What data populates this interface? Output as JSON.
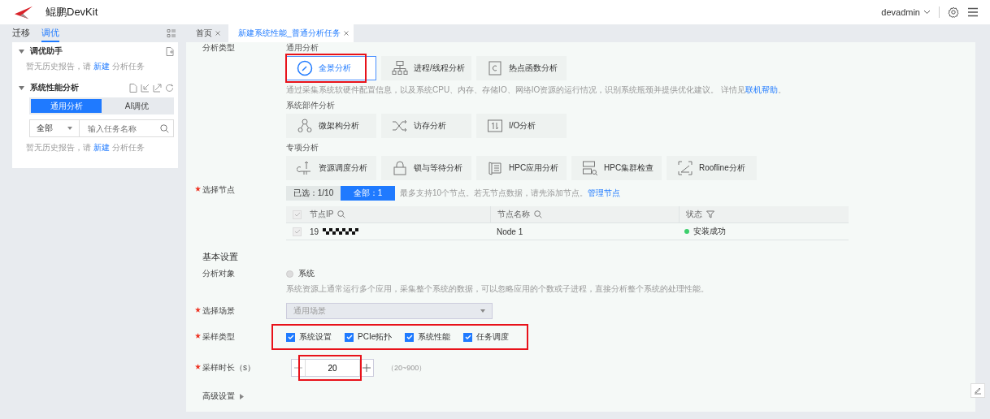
{
  "app": {
    "title": "鲲鹏DevKit",
    "user": "devadmin"
  },
  "sidebar": {
    "tabs": [
      {
        "label": "迁移",
        "selected": false
      },
      {
        "label": "调优",
        "selected": true
      }
    ],
    "sections": [
      {
        "title": "调优助手",
        "expanded": true,
        "empty_text": "暂无历史报告，请 **新建** 分析任务"
      },
      {
        "title": "系统性能分析",
        "expanded": true,
        "empty_text": "暂无历史报告，请 **新建** 分析任务",
        "mode_tabs": [
          {
            "label": "通用分析",
            "selected": true
          },
          {
            "label": "AI调优",
            "selected": false
          }
        ],
        "filter": {
          "value": "全部",
          "placeholder": "输入任务名称"
        }
      }
    ]
  },
  "tabs": [
    {
      "label": "首页",
      "selected": false
    },
    {
      "label": "新建系统性能_普通分析任务",
      "selected": true
    }
  ],
  "form": {
    "analysis_type_label": "分析类型",
    "groups": [
      {
        "title": "通用分析",
        "cards": [
          {
            "label": "全景分析",
            "selected": true,
            "highlighted": true
          },
          {
            "label": "进程/线程分析",
            "selected": false,
            "highlighted": false
          },
          {
            "label": "热点函数分析",
            "selected": false,
            "highlighted": false
          }
        ],
        "description": "通过采集系统软硬件配置信息，以及系统CPU、内存、存储IO、网络IO资源的运行情况，识别系统瓶颈并提供优化建议。 详情见",
        "link": "联机帮助",
        "after_link": "。"
      },
      {
        "title": "系统部件分析",
        "cards": [
          {
            "label": "微架构分析",
            "selected": false,
            "highlighted": false
          },
          {
            "label": "访存分析",
            "selected": false,
            "highlighted": false
          },
          {
            "label": "I/O分析",
            "selected": false,
            "highlighted": false
          }
        ]
      },
      {
        "title": "专项分析",
        "cards": [
          {
            "label": "资源调度分析",
            "selected": false,
            "highlighted": false
          },
          {
            "label": "锁与等待分析",
            "selected": false,
            "highlighted": false
          },
          {
            "label": "HPC应用分析",
            "selected": false,
            "highlighted": false
          },
          {
            "label": "HPC集群检查",
            "selected": false,
            "highlighted": false
          },
          {
            "label": "Roofline分析",
            "selected": false,
            "highlighted": false
          }
        ]
      }
    ],
    "node": {
      "label": "选择节点",
      "required": true,
      "toggles": [
        {
          "label": "已选：1/10",
          "selected": false
        },
        {
          "label": "全部：1",
          "selected": true
        }
      ],
      "hint": "最多支持10个节点。若无节点数据，请先添加节点。",
      "link": "管理节点",
      "columns": [
        "节点IP",
        "节点名称",
        "状态"
      ],
      "select_all_checked": false,
      "rows": [
        {
          "ip": "19",
          "checked": false,
          "name": "Node 1",
          "status": "安装成功",
          "color": "#3ccf6c"
        }
      ]
    },
    "basic_title": "基本设置",
    "target": {
      "label": "分析对象",
      "option": "系统",
      "selected": false,
      "description": "系统资源上通常运行多个应用，采集整个系统的数据，可以忽略应用的个数或子进程，直接分析整个系统的处理性能。"
    },
    "scene": {
      "label": "选择场景",
      "required": true,
      "value": "通用场景",
      "disabled": true
    },
    "sample_types": {
      "label": "采样类型",
      "required": true,
      "highlighted": true,
      "options": [
        {
          "label": "系统设置",
          "checked": true
        },
        {
          "label": "PCIe拓扑",
          "checked": true
        },
        {
          "label": "系统性能",
          "checked": true
        },
        {
          "label": "任务调度",
          "checked": true
        }
      ]
    },
    "duration": {
      "label": "采样时长（s）",
      "required": true,
      "value": "20",
      "range": "（20~900）",
      "highlighted": true
    },
    "advanced": {
      "label": "高级设置",
      "expanded": false
    }
  }
}
